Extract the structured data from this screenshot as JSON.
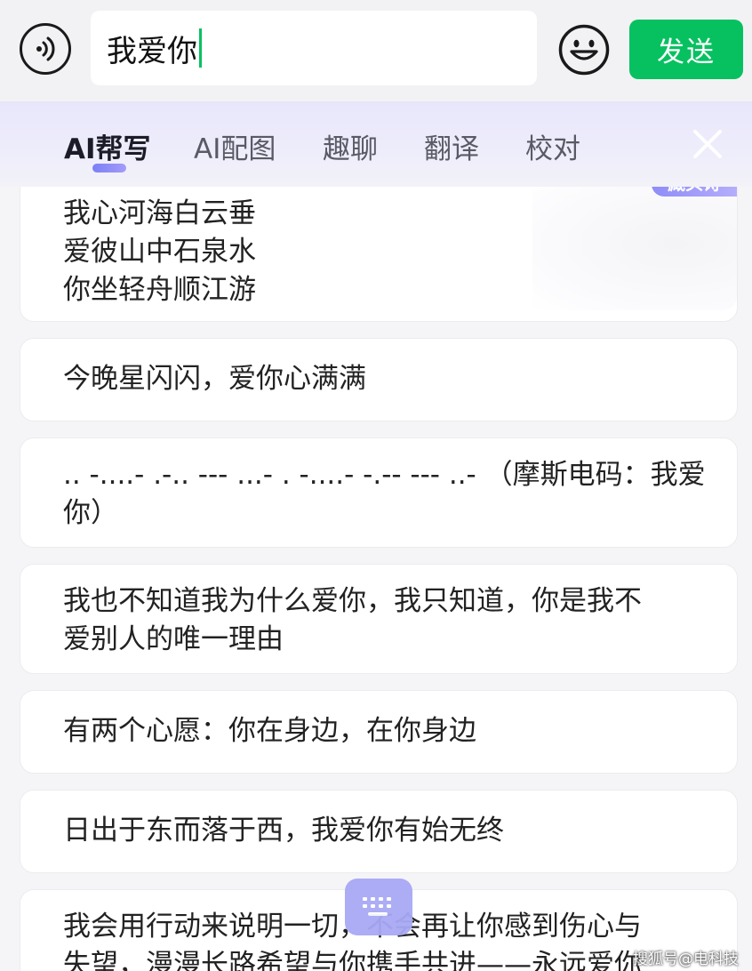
{
  "input": {
    "value": "我爱你",
    "send_label": "发送"
  },
  "tabs": [
    {
      "label": "AI帮写",
      "active": true
    },
    {
      "label": "AI配图",
      "active": false
    },
    {
      "label": "趣聊",
      "active": false
    },
    {
      "label": "翻译",
      "active": false
    },
    {
      "label": "校对",
      "active": false
    }
  ],
  "suggestions": [
    {
      "badge": "藏头诗",
      "lines": [
        "我心河海白云垂",
        "爱彼山中石泉水",
        "你坐轻舟顺江游"
      ]
    },
    {
      "lines": [
        "今晚星闪闪，爱你心满满"
      ]
    },
    {
      "lines": [
        ".. -....- .-.. --- ...- . -....- -.-- --- ..- （摩斯电码：我爱",
        "你）"
      ]
    },
    {
      "lines": [
        "我也不知道我为什么爱你，我只知道，你是我不",
        "爱别人的唯一理由"
      ]
    },
    {
      "lines": [
        "有两个心愿：你在身边，在你身边"
      ]
    },
    {
      "lines": [
        "日出于东而落于西，我爱你有始无终"
      ]
    },
    {
      "lines": [
        "我会用行动来说明一切，不会再让你感到伤心与",
        "失望，漫漫长路希望与你携手共进——永远爱你"
      ]
    }
  ],
  "watermark": "搜狐号@电科技",
  "colors": {
    "accent_green": "#07c160",
    "tab_accent": "#7b7ff5",
    "keyboard_button": "#a8a9f5"
  },
  "icons": {
    "voice": "voice-icon",
    "emoji": "emoji-icon",
    "close": "close-icon",
    "keyboard": "keyboard-icon"
  }
}
